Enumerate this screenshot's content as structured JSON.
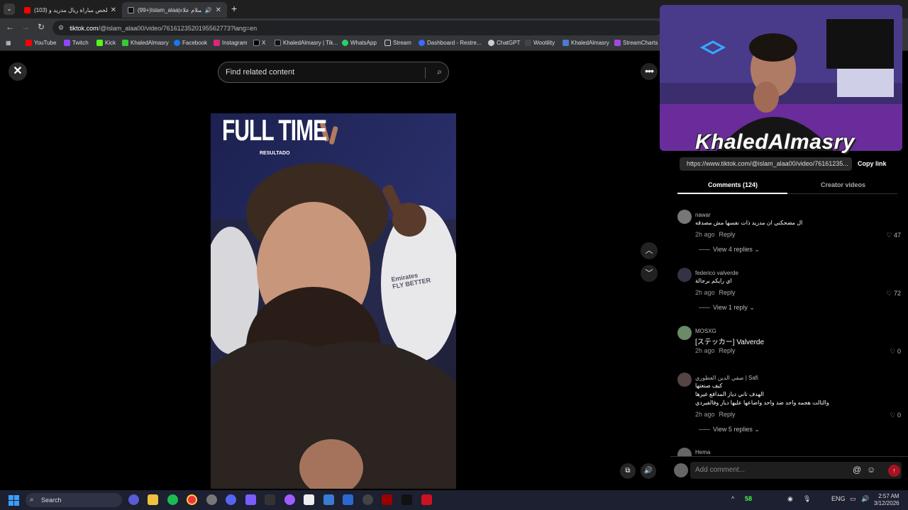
{
  "browser": {
    "tabs": [
      {
        "title": "(103) ملخص مباراة ريال مدريد و",
        "close": "✕"
      },
      {
        "title": "(99+)Islam_alaa|اسلام علاء",
        "close": "✕"
      }
    ],
    "new_tab": "+",
    "url_domain": "tiktok.com",
    "url_path": "/@islam_alaa00/video/7616123520195562773?lang=en",
    "bookmarks": [
      "YouTube",
      "Twitch",
      "Kick",
      "KhaledAlmasry",
      "Facebook",
      "Instagram",
      "X",
      "KhaledAlmasry | Tik...",
      "WhatsApp",
      "Stream",
      "Dashboard - Restre...",
      "ChatGPT",
      "Wootility",
      "KhaledAlmasry",
      "StreamCharts"
    ]
  },
  "player": {
    "search_placeholder": "Find related content",
    "video_overlay_title": "FULL TIME",
    "video_overlay_sub": "RESULTADO",
    "jersey_text": "Emirates FLY BETTER"
  },
  "overlay": {
    "streamer_name": "KhaledAlmasry"
  },
  "panel": {
    "share_link": "https://www.tiktok.com/@islam_alaa00/video/76161235...",
    "copy_link": "Copy link",
    "tab_comments": "Comments (124)",
    "tab_creator": "Creator videos",
    "comments": [
      {
        "name": "nawar",
        "text": "ال مضحكني ان مدريد ذات نفسها مش مصدقه",
        "time": "2h ago",
        "reply": "Reply",
        "likes": "47",
        "replies": "View 4 replies"
      },
      {
        "name": "federico valverde",
        "text": "اي رايكم برجالة",
        "time": "2h ago",
        "reply": "Reply",
        "likes": "72",
        "replies": "View 1 reply"
      },
      {
        "name": "MOSXG",
        "text": "[ステッカー] Valverde",
        "time": "2h ago",
        "reply": "Reply",
        "likes": "0",
        "replies": ""
      },
      {
        "name": "صفي الدين العطوري | Safi",
        "text": "كيف صنعتها",
        "text2": "الهدف تاني دياز المدافع غيرها",
        "text3": "والتالت هجمه واحد ضد واحد واضاعها عليها دياز وفالفيردي",
        "time": "2h ago",
        "reply": "Reply",
        "likes": "0",
        "replies": "View 5 replies"
      },
      {
        "name": "Hema",
        "text": "",
        "time": "",
        "reply": "",
        "likes": "",
        "replies": ""
      }
    ],
    "add_comment_placeholder": "Add comment...",
    "mention": "@"
  },
  "taskbar": {
    "search": "Search",
    "temp": "58",
    "lang": "ENG",
    "time": "2:57 AM",
    "date": "3/12/2026"
  },
  "colors": {
    "accent": "#fe2c55",
    "panel_bg": "#000000"
  }
}
